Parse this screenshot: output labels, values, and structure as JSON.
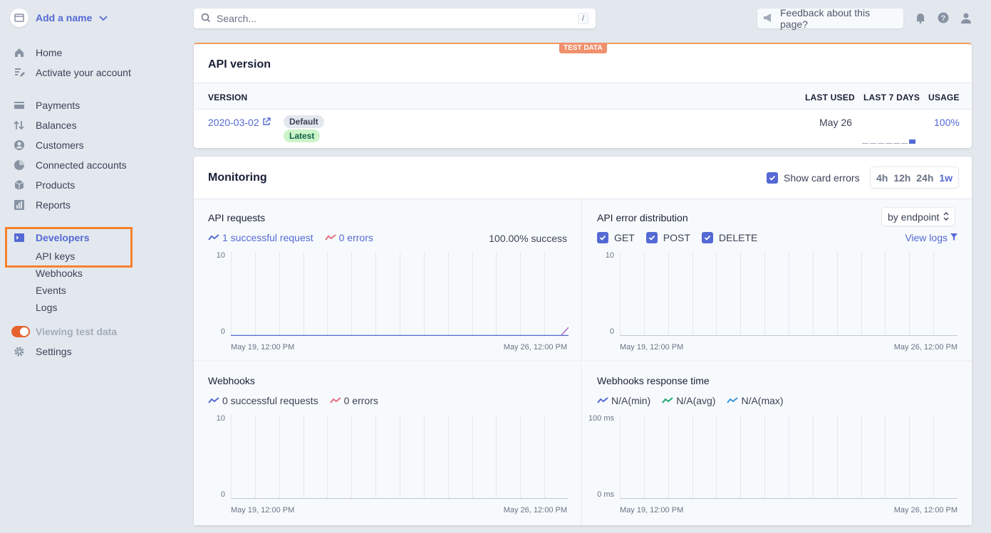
{
  "sidebar": {
    "account_name": "Add a name",
    "items": [
      {
        "label": "Home"
      },
      {
        "label": "Activate your account"
      },
      {
        "label": "Payments"
      },
      {
        "label": "Balances"
      },
      {
        "label": "Customers"
      },
      {
        "label": "Connected accounts"
      },
      {
        "label": "Products"
      },
      {
        "label": "Reports"
      },
      {
        "label": "Developers"
      }
    ],
    "dev_sub": [
      "API keys",
      "Webhooks",
      "Events",
      "Logs"
    ],
    "test_data_label": "Viewing test data",
    "settings_label": "Settings"
  },
  "topbar": {
    "search_placeholder": "Search...",
    "search_shortcut": "/",
    "feedback_label": "Feedback about this page?"
  },
  "api_version": {
    "badge": "TEST DATA",
    "title": "API version",
    "columns": {
      "version": "VERSION",
      "last_used": "LAST USED",
      "last7": "LAST 7 DAYS",
      "usage": "USAGE"
    },
    "row": {
      "version": "2020-03-02",
      "tag_default": "Default",
      "tag_latest": "Latest",
      "last_used": "May 26",
      "usage": "100%",
      "last7_bars": [
        0,
        0,
        0,
        0,
        0,
        0,
        1
      ]
    }
  },
  "monitoring": {
    "title": "Monitoring",
    "show_card_errors": "Show card errors",
    "ranges": [
      "4h",
      "12h",
      "24h",
      "1w"
    ],
    "selected_range": "1w",
    "api_requests": {
      "title": "API requests",
      "legend_success": "1 successful request",
      "legend_errors": "0 errors",
      "success_rate": "100.00% success",
      "y_max": "10",
      "y_min": "0",
      "x_start": "May 19, 12:00 PM",
      "x_end": "May 26, 12:00 PM"
    },
    "api_errors": {
      "title": "API error distribution",
      "select_label": "by endpoint",
      "filters": [
        "GET",
        "POST",
        "DELETE"
      ],
      "view_logs": "View logs",
      "y_max": "10",
      "y_min": "0",
      "x_start": "May 19, 12:00 PM",
      "x_end": "May 26, 12:00 PM"
    },
    "webhooks": {
      "title": "Webhooks",
      "legend_success": "0 successful requests",
      "legend_errors": "0 errors",
      "y_max": "10",
      "y_min": "0",
      "x_start": "May 19, 12:00 PM",
      "x_end": "May 26, 12:00 PM"
    },
    "webhooks_time": {
      "title": "Webhooks response time",
      "legend_min": "N/A(min)",
      "legend_avg": "N/A(avg)",
      "legend_max": "N/A(max)",
      "y_max": "100 ms",
      "y_min": "0 ms",
      "x_start": "May 19, 12:00 PM",
      "x_end": "May 26, 12:00 PM"
    }
  },
  "colors": {
    "accent": "#5469d4",
    "error": "#e56f7f",
    "avg": "#1ea672",
    "test": "#f0906c",
    "highlight": "#f7822c"
  }
}
